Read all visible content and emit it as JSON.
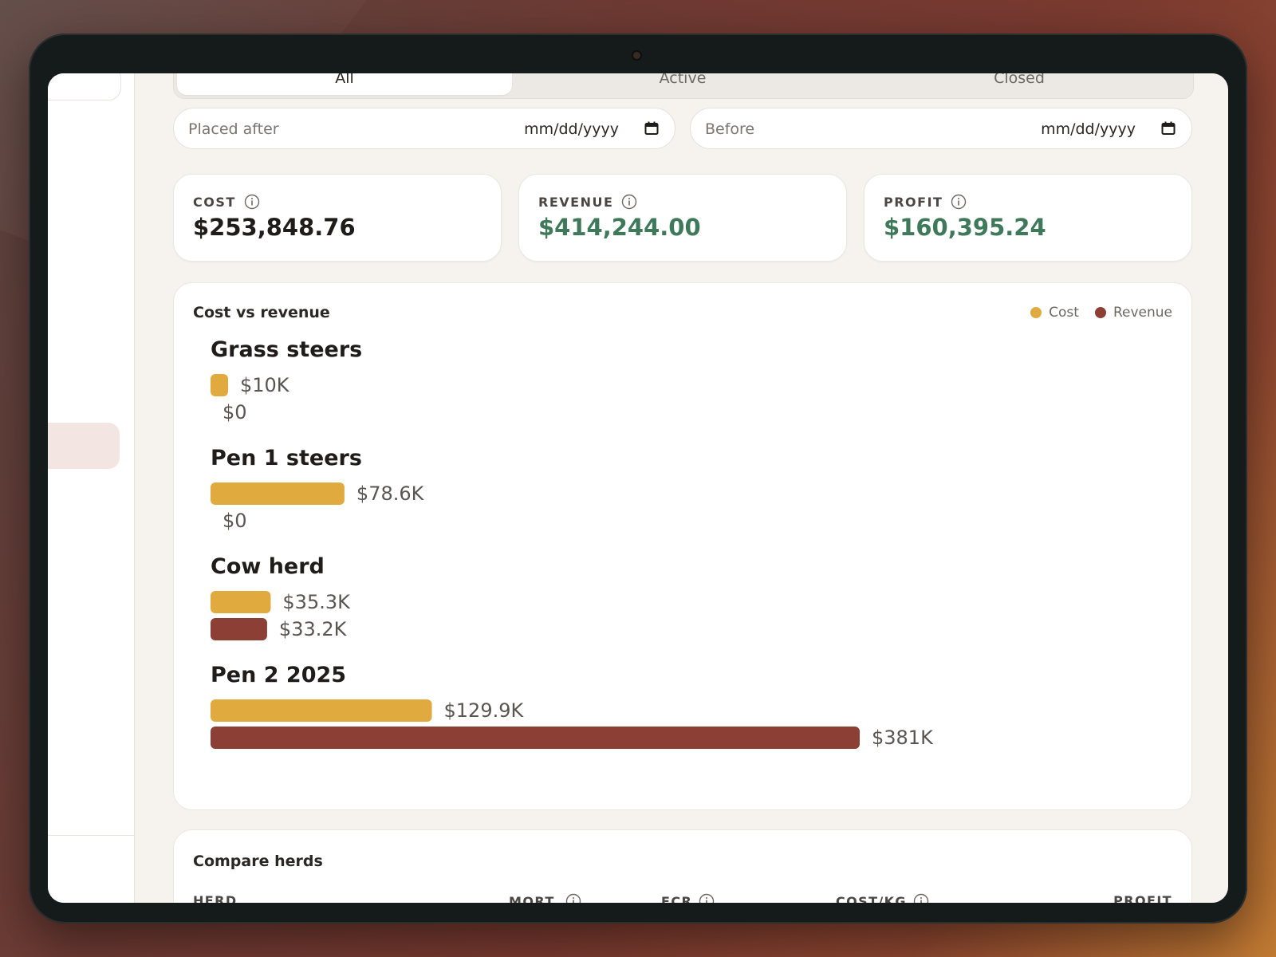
{
  "tabs": [
    {
      "label": "All",
      "active": true
    },
    {
      "label": "Active",
      "active": false
    },
    {
      "label": "Closed",
      "active": false
    }
  ],
  "filters": {
    "after": {
      "label": "Placed after",
      "placeholder": "mm/dd/yyyy"
    },
    "before": {
      "label": "Before",
      "placeholder": "mm/dd/yyyy"
    }
  },
  "stats": [
    {
      "label": "COST",
      "value": "$253,848.76",
      "tone": "neutral"
    },
    {
      "label": "REVENUE",
      "value": "$414,244.00",
      "tone": "positive"
    },
    {
      "label": "PROFIT",
      "value": "$160,395.24",
      "tone": "positive"
    }
  ],
  "colors": {
    "cost": "#e0aa3e",
    "revenue": "#8b3f35",
    "positive": "#3e7a5a"
  },
  "chart_data": {
    "type": "bar",
    "orientation": "horizontal",
    "title": "Cost vs revenue",
    "legend": {
      "placement": "top-right",
      "entries": [
        "Cost",
        "Revenue"
      ]
    },
    "categories": [
      "Grass steers",
      "Pen 1 steers",
      "Cow herd",
      "Pen 2 2025"
    ],
    "series": [
      {
        "name": "Cost",
        "values": [
          10000,
          78600,
          35300,
          129900
        ],
        "labels": [
          "$10K",
          "$78.6K",
          "$35.3K",
          "$129.9K"
        ]
      },
      {
        "name": "Revenue",
        "values": [
          0,
          0,
          33200,
          381000
        ],
        "labels": [
          "$0",
          "$0",
          "$33.2K",
          "$381K"
        ]
      }
    ],
    "grid": false
  },
  "compare": {
    "title": "Compare herds",
    "columns": [
      {
        "label": "HERD",
        "info": false
      },
      {
        "label": "MORT.",
        "info": true
      },
      {
        "label": "FCR",
        "info": true
      },
      {
        "label": "COST/KG",
        "info": true
      },
      {
        "label": "PROFIT",
        "info": false
      }
    ]
  }
}
